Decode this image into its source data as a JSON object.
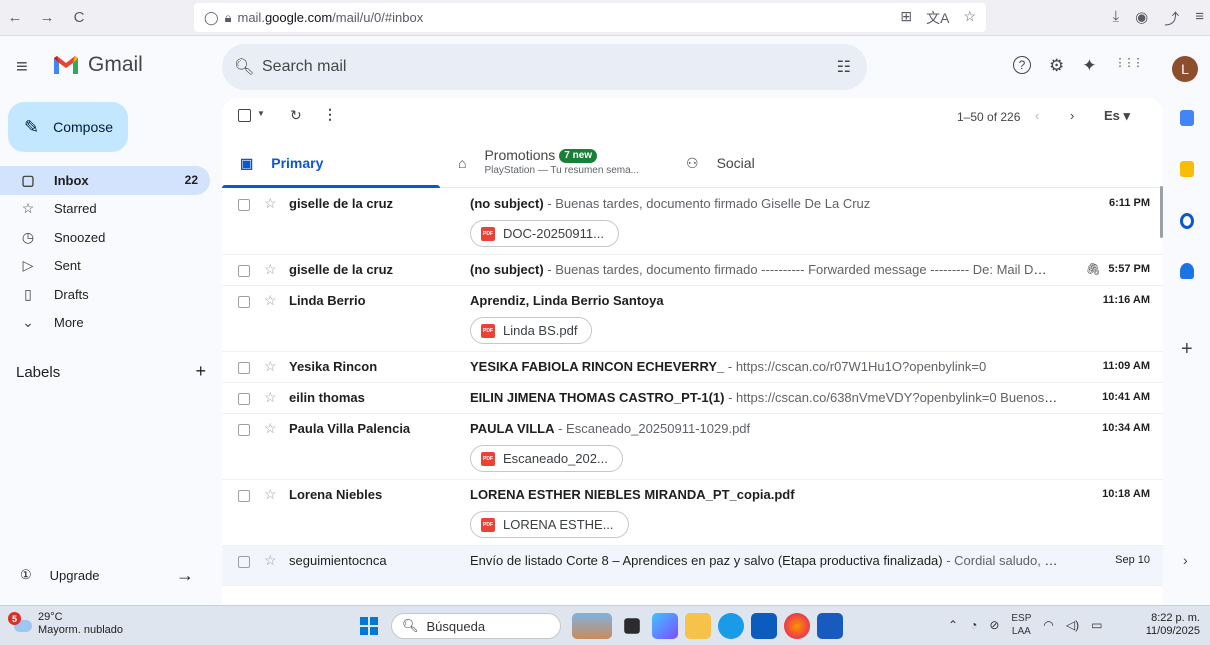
{
  "browser": {
    "back": "←",
    "forward": "→",
    "reload": "C",
    "url_prefix": "mail.",
    "url_host": "google.com",
    "url_path": "/mail/u/0/#inbox",
    "url_icons": [
      "⊞",
      "文A",
      "☆"
    ],
    "right_icons": [
      "⤓",
      "◉",
      "⤴",
      "≡"
    ]
  },
  "header": {
    "app_name": "Gmail",
    "search_placeholder": "Search mail",
    "help": "?",
    "settings": "⚙",
    "gemini": "✦",
    "apps": "⋮⋮⋮",
    "avatar_letter": "L"
  },
  "sidebar": {
    "compose_label": "Compose",
    "items": [
      {
        "icon": "▢",
        "label": "Inbox",
        "count": "22"
      },
      {
        "icon": "☆",
        "label": "Starred",
        "count": ""
      },
      {
        "icon": "◷",
        "label": "Snoozed",
        "count": ""
      },
      {
        "icon": "▷",
        "label": "Sent",
        "count": ""
      },
      {
        "icon": "▯",
        "label": "Drafts",
        "count": ""
      },
      {
        "icon": "⌄",
        "label": "More",
        "count": ""
      }
    ],
    "labels_heading": "Labels",
    "labels_add": "+",
    "upgrade_label": "Upgrade",
    "upgrade_arrow": "→"
  },
  "toolbar": {
    "pagination": "1–50 of 226",
    "prev": "‹",
    "next": "›",
    "input_tools": "Es ▾"
  },
  "tabs": {
    "primary": "Primary",
    "promotions": "Promotions",
    "promotions_badge": "7 new",
    "promotions_sub": "PlayStation — Tu resumen sema...",
    "social": "Social"
  },
  "emails": [
    {
      "sender": "giselle de la cruz",
      "subject": "(no subject)",
      "snippet": " - Buenas tardes, documento firmado Giselle De La Cruz",
      "time": "6:11 PM",
      "attachment": "DOC-20250911...",
      "clip": false,
      "read": false
    },
    {
      "sender": "giselle de la cruz",
      "subject": "(no subject)",
      "snippet": " - Buenas tardes, documento firmado ---------- Forwarded message --------- De: Mail De...",
      "time": "5:57 PM",
      "attachment": "",
      "clip": true,
      "read": false
    },
    {
      "sender": "Linda Berrio",
      "subject": "Aprendiz, Linda Berrio Santoya",
      "snippet": "",
      "time": "11:16 AM",
      "attachment": "Linda BS.pdf",
      "clip": false,
      "read": false
    },
    {
      "sender": "Yesika Rincon",
      "subject": "YESIKA FABIOLA RINCON ECHEVERRY_",
      "snippet": " - https://cscan.co/r07W1Hu1O?openbylink=0",
      "time": "11:09 AM",
      "attachment": "",
      "clip": false,
      "read": false
    },
    {
      "sender": "eilin thomas",
      "subject": "EILIN JIMENA THOMAS CASTRO_PT-1(1)",
      "snippet": " - https://cscan.co/638nVmeVDY?openbylink=0 Buenos días",
      "time": "10:41 AM",
      "attachment": "",
      "clip": false,
      "read": false
    },
    {
      "sender": "Paula Villa Palencia",
      "subject": "PAULA VILLA",
      "snippet": " - Escaneado_20250911-1029.pdf",
      "time": "10:34 AM",
      "attachment": "Escaneado_202...",
      "clip": false,
      "read": false
    },
    {
      "sender": "Lorena Niebles",
      "subject": "LORENA ESTHER NIEBLES MIRANDA_PT_copia.pdf",
      "snippet": "",
      "time": "10:18 AM",
      "attachment": "LORENA ESTHE...",
      "clip": false,
      "read": false
    },
    {
      "sender": "seguimientocnca",
      "subject": "Envío de listado Corte 8 – Aprendices en paz y salvo (Etapa productiva finalizada)",
      "snippet": " - Cordial saludo, esti...",
      "time": "Sep 10",
      "attachment": "",
      "clip": false,
      "read": true
    }
  ],
  "taskbar": {
    "weather_badge": "5",
    "temperature": "29°C",
    "condition": "Mayorm. nublado",
    "search_placeholder": "Búsqueda",
    "lang_top": "ESP",
    "lang_bottom": "LAA",
    "time": "8:22 p. m.",
    "date": "11/09/2025"
  },
  "colors": {
    "compose_bg": "#c2e7ff",
    "active_nav": "#d3e3fd",
    "primary_tab": "#0b57d0",
    "badge": "#188038",
    "pdf": "#ea4335"
  }
}
